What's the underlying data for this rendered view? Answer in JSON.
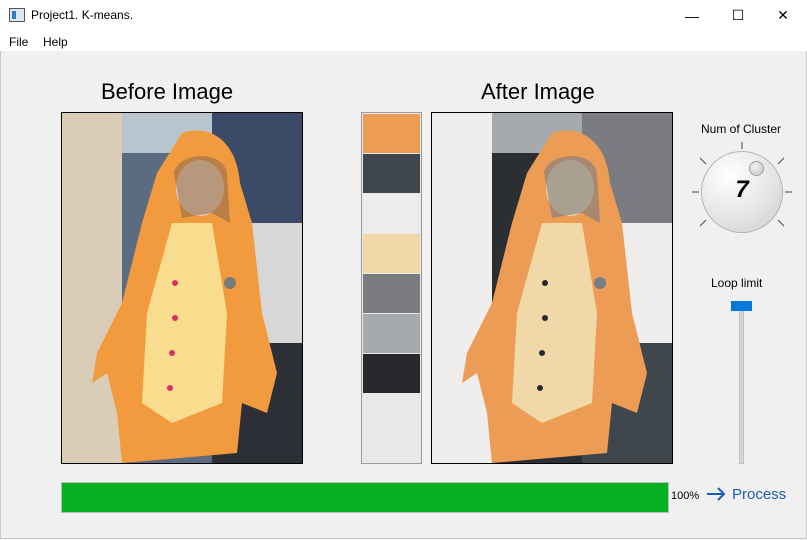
{
  "window": {
    "title": "Project1. K-means.",
    "minimize": "—",
    "maximize": "☐",
    "close": "✕"
  },
  "menu": {
    "items": [
      "File",
      "Help"
    ]
  },
  "headings": {
    "before": "Before Image",
    "after": "After Image"
  },
  "palette": {
    "colors": [
      "#ec9c55",
      "#3f474d",
      "#eeecea",
      "#f0d8a8",
      "#7b7c7f",
      "#a6a9ad",
      "#26282c",
      "#e8e8e8"
    ]
  },
  "cluster": {
    "label": "Num of Cluster",
    "value": "7"
  },
  "loop": {
    "label": "Loop limit",
    "level": 1.0
  },
  "progress": {
    "percent": 100,
    "text": "100%"
  },
  "process": {
    "label": "Process",
    "icon": "arrow-right-icon"
  },
  "image_colors": {
    "orange": "#e48d3b",
    "cream": "#f4d59a",
    "dark": "#2b2e33",
    "gray": "#8a8d92",
    "light": "#efeeec"
  }
}
